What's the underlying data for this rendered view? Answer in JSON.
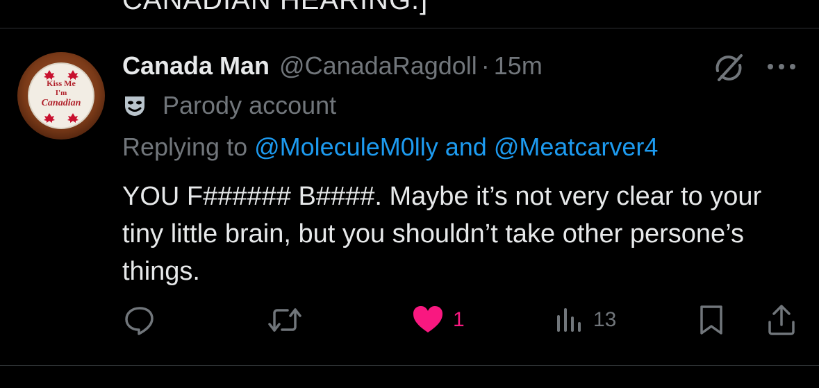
{
  "previous_tweet": {
    "tail_text": "CANADIAN HEARING.]"
  },
  "tweet": {
    "avatar": {
      "badge_lines": [
        "Kiss Me",
        "I'm",
        "Canadian"
      ],
      "colors": {
        "outer": "#8b3a1c",
        "ring": "#ffffff",
        "text": "#b0202a",
        "leaf": "#c8102e"
      }
    },
    "display_name": "Canada Man",
    "handle": "@CanadaRagdoll",
    "dot": "·",
    "timestamp": "15m",
    "parody_label": "Parody account",
    "replying_prefix": "Replying to",
    "reply_mentions": [
      "@MoleculeM0lly",
      "@Meatcarver4"
    ],
    "reply_joiner": "and",
    "text": "YOU F###### B####. Maybe it’s not very clear to your tiny little brain, but you shouldn’t take other persone’s things.",
    "actions": {
      "reply": {
        "icon": "reply-icon",
        "count": ""
      },
      "retweet": {
        "icon": "retweet-icon",
        "count": ""
      },
      "like": {
        "icon": "heart-icon",
        "count": "1",
        "liked": true
      },
      "views": {
        "icon": "views-icon",
        "count": "13"
      },
      "bookmark": {
        "icon": "bookmark-icon"
      },
      "share": {
        "icon": "share-icon"
      }
    },
    "colors": {
      "background": "#000000",
      "text": "#e7e9ea",
      "muted": "#71767b",
      "link": "#1d9bf0",
      "like": "#f91880",
      "divider": "#2f3336"
    }
  }
}
